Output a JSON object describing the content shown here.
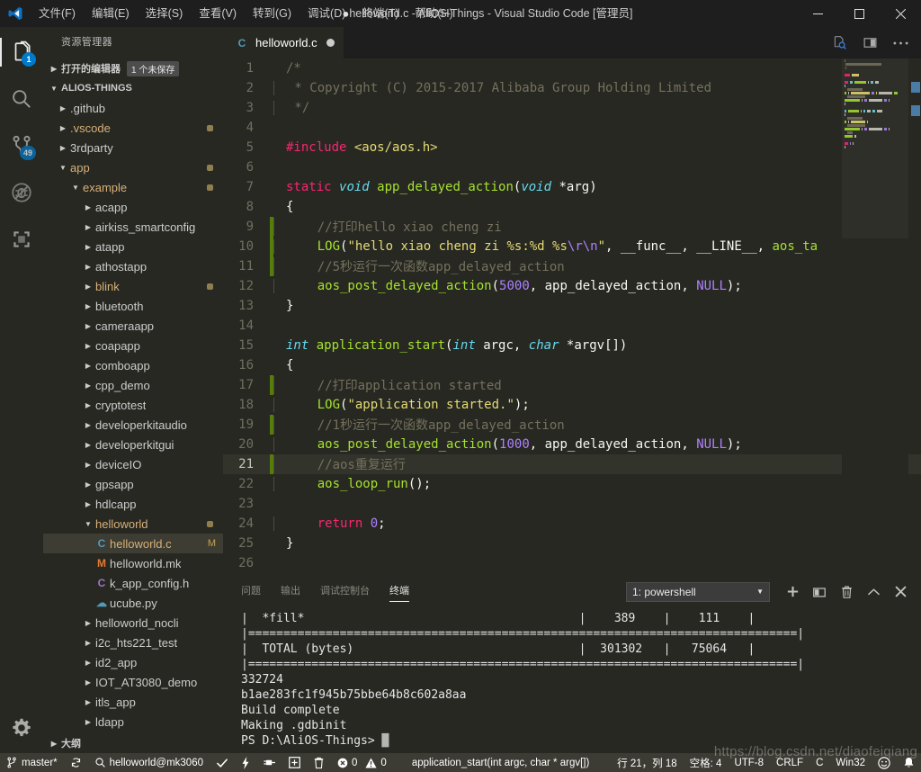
{
  "titlebar": {
    "logo_icon": "vscode-logo-icon",
    "menus": [
      "文件(F)",
      "编辑(E)",
      "选择(S)",
      "查看(V)",
      "转到(G)",
      "调试(D)",
      "终端(T)",
      "帮助(H)"
    ],
    "window_title": "helloworld.c - AliOS-Things - Visual Studio Code [管理员]",
    "dirty_indicator": "●",
    "minimize_label": "—",
    "maximize_label": "☐",
    "close_label": "✕"
  },
  "activitybar": {
    "items": [
      {
        "name": "explorer",
        "icon": "files-icon",
        "badge": "1",
        "active": true
      },
      {
        "name": "search",
        "icon": "search-icon",
        "badge": "",
        "active": false
      },
      {
        "name": "source-control",
        "icon": "source-control-icon",
        "badge": "49",
        "active": false
      },
      {
        "name": "debug",
        "icon": "debug-icon",
        "badge": "",
        "active": false
      },
      {
        "name": "extensions",
        "icon": "extensions-icon",
        "badge": "",
        "active": false
      }
    ],
    "settings_icon": "gear-icon"
  },
  "sidebar": {
    "title": "资源管理器",
    "open_editors_label": "打开的编辑器",
    "unsaved_badge": "1 个未保存",
    "project_label": "ALIOS-THINGS",
    "outline_label": "大纲",
    "tree": [
      {
        "label": ".github",
        "indent": 1,
        "type": "folder",
        "expanded": false,
        "dot": false,
        "mark": ""
      },
      {
        "label": ".vscode",
        "indent": 1,
        "type": "folder",
        "expanded": false,
        "dot": true,
        "mark": "",
        "amber": true
      },
      {
        "label": "3rdparty",
        "indent": 1,
        "type": "folder",
        "expanded": false,
        "dot": false,
        "mark": ""
      },
      {
        "label": "app",
        "indent": 1,
        "type": "folder",
        "expanded": true,
        "dot": true,
        "mark": "",
        "amber": true
      },
      {
        "label": "example",
        "indent": 2,
        "type": "folder",
        "expanded": true,
        "dot": true,
        "mark": "",
        "amber": true
      },
      {
        "label": "acapp",
        "indent": 3,
        "type": "folder",
        "expanded": false,
        "dot": false,
        "mark": ""
      },
      {
        "label": "airkiss_smartconfig",
        "indent": 3,
        "type": "folder",
        "expanded": false,
        "dot": false,
        "mark": ""
      },
      {
        "label": "atapp",
        "indent": 3,
        "type": "folder",
        "expanded": false,
        "dot": false,
        "mark": ""
      },
      {
        "label": "athostapp",
        "indent": 3,
        "type": "folder",
        "expanded": false,
        "dot": false,
        "mark": ""
      },
      {
        "label": "blink",
        "indent": 3,
        "type": "folder",
        "expanded": false,
        "dot": true,
        "mark": "",
        "amber": true
      },
      {
        "label": "bluetooth",
        "indent": 3,
        "type": "folder",
        "expanded": false,
        "dot": false,
        "mark": ""
      },
      {
        "label": "cameraapp",
        "indent": 3,
        "type": "folder",
        "expanded": false,
        "dot": false,
        "mark": ""
      },
      {
        "label": "coapapp",
        "indent": 3,
        "type": "folder",
        "expanded": false,
        "dot": false,
        "mark": ""
      },
      {
        "label": "comboapp",
        "indent": 3,
        "type": "folder",
        "expanded": false,
        "dot": false,
        "mark": ""
      },
      {
        "label": "cpp_demo",
        "indent": 3,
        "type": "folder",
        "expanded": false,
        "dot": false,
        "mark": ""
      },
      {
        "label": "cryptotest",
        "indent": 3,
        "type": "folder",
        "expanded": false,
        "dot": false,
        "mark": ""
      },
      {
        "label": "developerkitaudio",
        "indent": 3,
        "type": "folder",
        "expanded": false,
        "dot": false,
        "mark": ""
      },
      {
        "label": "developerkitgui",
        "indent": 3,
        "type": "folder",
        "expanded": false,
        "dot": false,
        "mark": ""
      },
      {
        "label": "deviceIO",
        "indent": 3,
        "type": "folder",
        "expanded": false,
        "dot": false,
        "mark": ""
      },
      {
        "label": "gpsapp",
        "indent": 3,
        "type": "folder",
        "expanded": false,
        "dot": false,
        "mark": ""
      },
      {
        "label": "hdlcapp",
        "indent": 3,
        "type": "folder",
        "expanded": false,
        "dot": false,
        "mark": ""
      },
      {
        "label": "helloworld",
        "indent": 3,
        "type": "folder",
        "expanded": true,
        "dot": true,
        "mark": "",
        "amber": true
      },
      {
        "label": "helloworld.c",
        "indent": 4,
        "type": "file-c",
        "selected": true,
        "dot": false,
        "mark": "M",
        "amber": true
      },
      {
        "label": "helloworld.mk",
        "indent": 4,
        "type": "file-mk",
        "dot": false,
        "mark": ""
      },
      {
        "label": "k_app_config.h",
        "indent": 4,
        "type": "file-h",
        "dot": false,
        "mark": ""
      },
      {
        "label": "ucube.py",
        "indent": 4,
        "type": "file-py",
        "dot": false,
        "mark": ""
      },
      {
        "label": "helloworld_nocli",
        "indent": 3,
        "type": "folder",
        "expanded": false,
        "dot": false,
        "mark": ""
      },
      {
        "label": "i2c_hts221_test",
        "indent": 3,
        "type": "folder",
        "expanded": false,
        "dot": false,
        "mark": ""
      },
      {
        "label": "id2_app",
        "indent": 3,
        "type": "folder",
        "expanded": false,
        "dot": false,
        "mark": ""
      },
      {
        "label": "IOT_AT3080_demo",
        "indent": 3,
        "type": "folder",
        "expanded": false,
        "dot": false,
        "mark": ""
      },
      {
        "label": "itls_app",
        "indent": 3,
        "type": "folder",
        "expanded": false,
        "dot": false,
        "mark": ""
      },
      {
        "label": "ldapp",
        "indent": 3,
        "type": "folder",
        "expanded": false,
        "dot": false,
        "mark": ""
      }
    ]
  },
  "editor": {
    "tab": {
      "label": "helloworld.c",
      "icon": "c-file-icon",
      "dirty": true
    },
    "actions": [
      {
        "name": "open-changes-icon"
      },
      {
        "name": "split-editor-icon"
      },
      {
        "name": "more-actions-icon"
      }
    ],
    "active_line": 21,
    "lines": [
      {
        "n": 1,
        "gutter": "",
        "indent": 0,
        "tokens": [
          {
            "t": "cmt",
            "s": "/*"
          }
        ]
      },
      {
        "n": 2,
        "gutter": "",
        "indent": 1,
        "tokens": [
          {
            "t": "cmt",
            "s": " * Copyright (C) 2015-2017 Alibaba Group Holding Limited"
          }
        ]
      },
      {
        "n": 3,
        "gutter": "",
        "indent": 1,
        "tokens": [
          {
            "t": "cmt",
            "s": " */"
          }
        ]
      },
      {
        "n": 4,
        "gutter": "",
        "indent": 1,
        "tokens": []
      },
      {
        "n": 5,
        "gutter": "",
        "indent": 0,
        "tokens": [
          {
            "t": "key",
            "s": "#include"
          },
          {
            "t": "pln",
            "s": " "
          },
          {
            "t": "str",
            "s": "<aos/aos.h>"
          }
        ]
      },
      {
        "n": 6,
        "gutter": "",
        "indent": 0,
        "tokens": []
      },
      {
        "n": 7,
        "gutter": "",
        "indent": 0,
        "tokens": [
          {
            "t": "key",
            "s": "static"
          },
          {
            "t": "pln",
            "s": " "
          },
          {
            "t": "type",
            "s": "void"
          },
          {
            "t": "pln",
            "s": " "
          },
          {
            "t": "fn",
            "s": "app_delayed_action"
          },
          {
            "t": "pln",
            "s": "("
          },
          {
            "t": "type",
            "s": "void"
          },
          {
            "t": "pln",
            "s": " *arg)"
          }
        ]
      },
      {
        "n": 8,
        "gutter": "",
        "indent": 0,
        "tokens": [
          {
            "t": "pln",
            "s": "{"
          }
        ]
      },
      {
        "n": 9,
        "gutter": "green",
        "indent": 1,
        "tokens": [
          {
            "t": "cmt",
            "s": "    //打印hello xiao cheng zi"
          }
        ]
      },
      {
        "n": 10,
        "gutter": "green",
        "indent": 1,
        "tokens": [
          {
            "t": "pln",
            "s": "    "
          },
          {
            "t": "fn",
            "s": "LOG"
          },
          {
            "t": "pln",
            "s": "("
          },
          {
            "t": "str",
            "s": "\"hello xiao cheng zi %s:%d %s"
          },
          {
            "t": "esc",
            "s": "\\r\\n"
          },
          {
            "t": "str",
            "s": "\""
          },
          {
            "t": "pln",
            "s": ", __func__, __LINE__, "
          },
          {
            "t": "fn",
            "s": "aos_ta"
          }
        ]
      },
      {
        "n": 11,
        "gutter": "green",
        "indent": 1,
        "tokens": [
          {
            "t": "cmt",
            "s": "    //5秒运行一次函数app_delayed_action"
          }
        ]
      },
      {
        "n": 12,
        "gutter": "",
        "indent": 1,
        "tokens": [
          {
            "t": "pln",
            "s": "    "
          },
          {
            "t": "fn",
            "s": "aos_post_delayed_action"
          },
          {
            "t": "pln",
            "s": "("
          },
          {
            "t": "num",
            "s": "5000"
          },
          {
            "t": "pln",
            "s": ", app_delayed_action, "
          },
          {
            "t": "esc",
            "s": "NULL"
          },
          {
            "t": "pln",
            "s": ");"
          }
        ]
      },
      {
        "n": 13,
        "gutter": "",
        "indent": 0,
        "tokens": [
          {
            "t": "pln",
            "s": "}"
          }
        ]
      },
      {
        "n": 14,
        "gutter": "",
        "indent": 0,
        "tokens": []
      },
      {
        "n": 15,
        "gutter": "",
        "indent": 0,
        "tokens": [
          {
            "t": "type",
            "s": "int"
          },
          {
            "t": "pln",
            "s": " "
          },
          {
            "t": "fn",
            "s": "application_start"
          },
          {
            "t": "pln",
            "s": "("
          },
          {
            "t": "type",
            "s": "int"
          },
          {
            "t": "pln",
            "s": " argc, "
          },
          {
            "t": "type",
            "s": "char"
          },
          {
            "t": "pln",
            "s": " *argv[])"
          }
        ]
      },
      {
        "n": 16,
        "gutter": "",
        "indent": 0,
        "tokens": [
          {
            "t": "pln",
            "s": "{"
          }
        ]
      },
      {
        "n": 17,
        "gutter": "green",
        "indent": 1,
        "tokens": [
          {
            "t": "cmt",
            "s": "    //打印application started"
          }
        ]
      },
      {
        "n": 18,
        "gutter": "",
        "indent": 1,
        "tokens": [
          {
            "t": "pln",
            "s": "    "
          },
          {
            "t": "fn",
            "s": "LOG"
          },
          {
            "t": "pln",
            "s": "("
          },
          {
            "t": "str",
            "s": "\"application started.\""
          },
          {
            "t": "pln",
            "s": ");"
          }
        ]
      },
      {
        "n": 19,
        "gutter": "green",
        "indent": 1,
        "tokens": [
          {
            "t": "cmt",
            "s": "    //1秒运行一次函数app_delayed_action"
          }
        ]
      },
      {
        "n": 20,
        "gutter": "",
        "indent": 1,
        "tokens": [
          {
            "t": "pln",
            "s": "    "
          },
          {
            "t": "fn",
            "s": "aos_post_delayed_action"
          },
          {
            "t": "pln",
            "s": "("
          },
          {
            "t": "num",
            "s": "1000"
          },
          {
            "t": "pln",
            "s": ", app_delayed_action, "
          },
          {
            "t": "esc",
            "s": "NULL"
          },
          {
            "t": "pln",
            "s": ");"
          }
        ]
      },
      {
        "n": 21,
        "gutter": "green",
        "indent": 1,
        "tokens": [
          {
            "t": "cmt",
            "s": "    //aos重复运行"
          }
        ]
      },
      {
        "n": 22,
        "gutter": "",
        "indent": 1,
        "tokens": [
          {
            "t": "pln",
            "s": "    "
          },
          {
            "t": "fn",
            "s": "aos_loop_run"
          },
          {
            "t": "pln",
            "s": "();"
          }
        ]
      },
      {
        "n": 23,
        "gutter": "",
        "indent": 1,
        "tokens": []
      },
      {
        "n": 24,
        "gutter": "",
        "indent": 1,
        "tokens": [
          {
            "t": "pln",
            "s": "    "
          },
          {
            "t": "key",
            "s": "return"
          },
          {
            "t": "pln",
            "s": " "
          },
          {
            "t": "num",
            "s": "0"
          },
          {
            "t": "pln",
            "s": ";"
          }
        ]
      },
      {
        "n": 25,
        "gutter": "",
        "indent": 0,
        "tokens": [
          {
            "t": "pln",
            "s": "}"
          }
        ]
      },
      {
        "n": 26,
        "gutter": "",
        "indent": 0,
        "tokens": []
      }
    ]
  },
  "panel": {
    "tabs": [
      {
        "label": "问题",
        "active": false
      },
      {
        "label": "输出",
        "active": false
      },
      {
        "label": "调试控制台",
        "active": false
      },
      {
        "label": "终端",
        "active": true
      }
    ],
    "terminal_select": "1: powershell",
    "actions": [
      {
        "name": "new-terminal-icon",
        "glyph": "+"
      },
      {
        "name": "split-terminal-icon",
        "glyph": "split"
      },
      {
        "name": "kill-terminal-icon",
        "glyph": "trash"
      },
      {
        "name": "maximize-panel-icon",
        "glyph": "chevron-up"
      },
      {
        "name": "close-panel-icon",
        "glyph": "✕"
      }
    ],
    "terminal_lines": [
      "|  *fill*                                       |    389    |    111    |",
      "|==============================================================================|",
      "|  TOTAL (bytes)                                |  301302   |   75064   |",
      "|==============================================================================|",
      "332724",
      "b1ae283fc1f945b75bbe64b8c602a8aa",
      "Build complete",
      "Making .gdbinit",
      "PS D:\\AliOS-Things> "
    ]
  },
  "statusbar": {
    "branch": "master*",
    "sync_icon": "sync-icon",
    "target": "helloworld@mk3060",
    "check_icon": "check-icon",
    "bolt_icon": "bolt-icon",
    "plug_icon": "plug-icon",
    "add_icon": "add-box-icon",
    "trash_icon": "trash-icon",
    "errors": "0",
    "warnings": "0",
    "symbol": "application_start(int argc, char * argv[])",
    "position": "行 21，列 18",
    "indent": "空格: 4",
    "encoding": "UTF-8",
    "eol": "CRLF",
    "language": "C",
    "platform": "Win32",
    "feedback_icon": "smiley-icon",
    "bell_icon": "bell-icon"
  },
  "watermark": "https://blog.csdn.net/diaofeiqiang",
  "colors": {
    "accent": "#007acc",
    "editor_bg": "#272822",
    "titlebar_bg": "#1e1e1e",
    "statusbar_bg": "#3c3c35",
    "selection_bg": "#3d3d34",
    "folder_amber": "#d7b079"
  }
}
